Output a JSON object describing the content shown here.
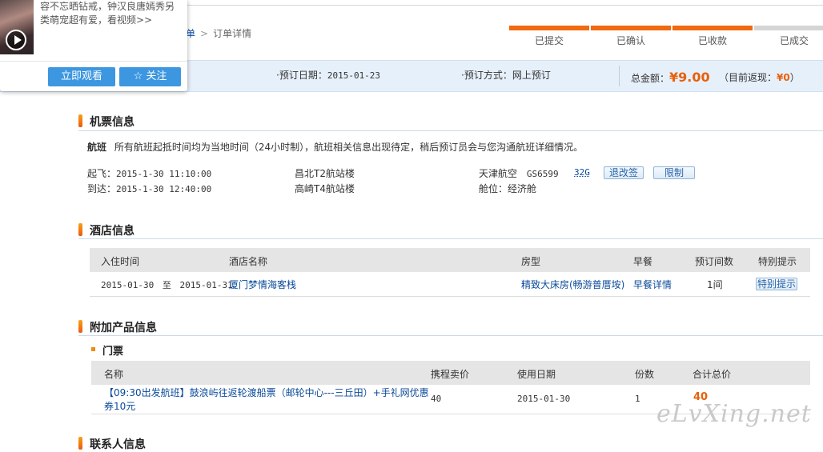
{
  "breadcrumb": {
    "prev": "单",
    "current": "订单详情"
  },
  "steps": [
    "已提交",
    "已确认",
    "已收款",
    "已成交"
  ],
  "summary": {
    "date_label": "·预订日期：",
    "date": "2015-01-23",
    "method_label": "·预订方式：",
    "method": "网上预订",
    "total_label": "总金额：",
    "total": "¥9.00",
    "rebate_label": "（目前返现：",
    "rebate": "¥0",
    "rebate_close": "）"
  },
  "flight": {
    "title": "机票信息",
    "note_label": "航班",
    "note": "所有航班起抵时间均为当地时间（24小时制），航班相关信息出现待定，稍后预订员会与您沟通航班详细情况。",
    "depart_label": "起飞：",
    "depart": "2015-1-30 11:10:00",
    "arrive_label": "到达：",
    "arrive": "2015-1-30 12:40:00",
    "from": "昌北T2航站楼",
    "to": "高崎T4航站楼",
    "airline": "天津航空",
    "flight_no": "GS6599",
    "plane": "32G",
    "change_btn": "退改签",
    "limit_btn": "限制",
    "cabin_label": "舱位：",
    "cabin": "经济舱"
  },
  "hotel": {
    "title": "酒店信息",
    "headers": [
      "入住时间",
      "酒店名称",
      "房型",
      "早餐",
      "预订间数",
      "特别提示"
    ],
    "row": {
      "checkin": "2015-01-30",
      "to": "至",
      "checkout": "2015-01-31",
      "name": "厦门梦情海客栈",
      "room": "精致大床房(畅游普厝垵)",
      "breakfast": "早餐详情",
      "rooms": "1间",
      "tip": "特别提示"
    }
  },
  "addon": {
    "title": "附加产品信息",
    "sub_title": "门票",
    "headers": [
      "名称",
      "携程卖价",
      "使用日期",
      "份数",
      "合计总价"
    ],
    "row": {
      "name_line1": "【09:30出发航班】鼓浪屿往返轮渡船票（邮轮中心---三丘田）+手礼网优惠",
      "name_line2": "券10元",
      "price": "40",
      "date": "2015-01-30",
      "qty": "1",
      "total": "40"
    }
  },
  "next_section": "联系人信息",
  "popup": {
    "text_line1": "容不忘晒钻戒，钟汉良唐嫣秀另",
    "text_line2": "类萌宠超有爱，看视频>>",
    "watch_btn": "立即观看",
    "follow_btn": "关注"
  },
  "watermark": "eLvXing.net",
  "colors": {
    "accent": "#f06a0f",
    "link": "#0a4a9a",
    "summary_bg": "#e6f0fa",
    "button_blue": "#3d97e0"
  }
}
